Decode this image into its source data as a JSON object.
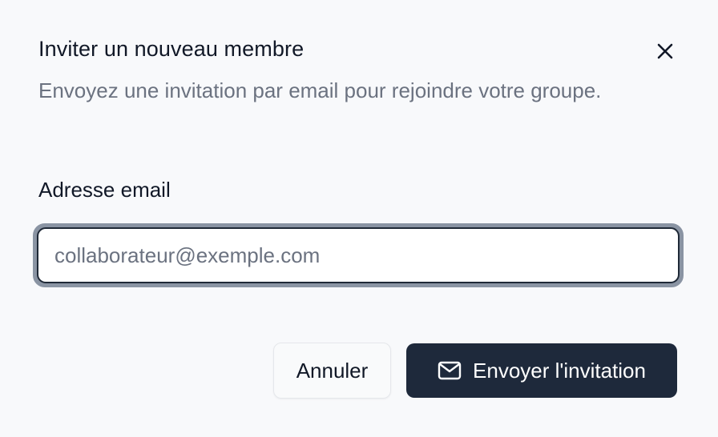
{
  "dialog": {
    "title": "Inviter un nouveau membre",
    "description": "Envoyez une invitation par email pour rejoindre votre groupe.",
    "close_icon": "close-icon"
  },
  "form": {
    "email_label": "Adresse email",
    "email_value": "",
    "email_placeholder": "collaborateur@exemple.com"
  },
  "actions": {
    "cancel_label": "Annuler",
    "send_label": "Envoyer l'invitation",
    "send_icon": "mail-icon"
  },
  "colors": {
    "primary": "#1e293b",
    "muted_text": "#6b7280",
    "focus_ring": "#8a94a3",
    "background": "#f8f9fb"
  }
}
